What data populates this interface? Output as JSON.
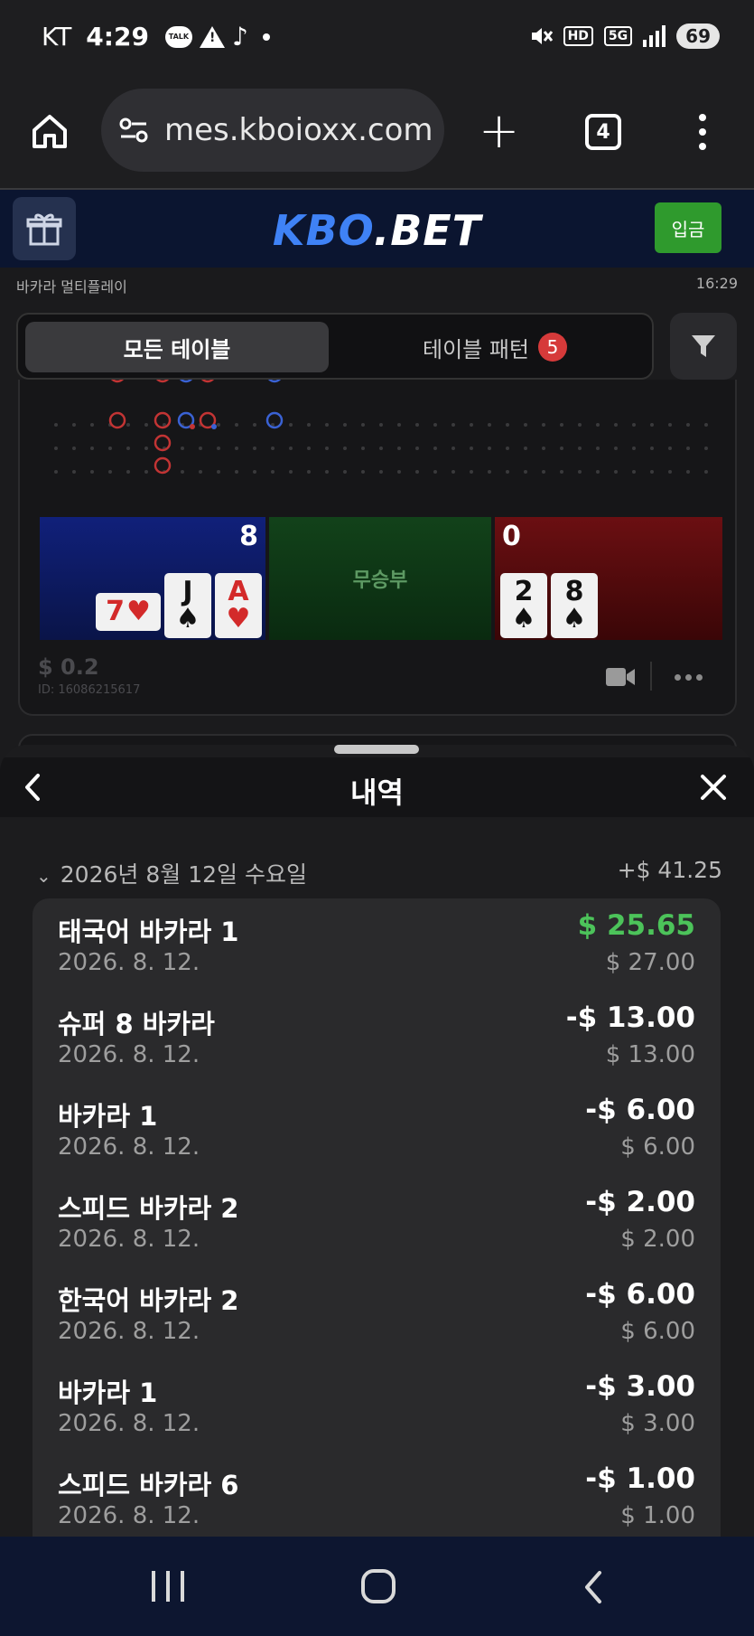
{
  "status_bar": {
    "carrier": "KT",
    "time": "4:29",
    "talk_icon_label": "TALK",
    "battery": "69",
    "hd_label": "HD",
    "net_label": "5G"
  },
  "browser": {
    "url": "mes.kboioxx.com",
    "tab_count": "4"
  },
  "site": {
    "logo_part1": "KBO",
    "logo_part2": ".BET",
    "deposit_label": "입금",
    "page_label": "바카라 멀티플레이",
    "clock": "16:29",
    "tabs": {
      "all_tables": "모든 테이블",
      "table_pattern": "테이블 패턴",
      "pattern_badge": "5"
    }
  },
  "game": {
    "player_score": "8",
    "banker_score": "0",
    "tie_label": "무승부",
    "player_cards": [
      {
        "rank": "7",
        "suit": "♥",
        "color": "red"
      },
      {
        "rank": "J",
        "suit": "♠",
        "color": "black"
      },
      {
        "rank": "A",
        "suit": "♥",
        "color": "red"
      }
    ],
    "banker_cards": [
      {
        "rank": "2",
        "suit": "♠",
        "color": "black"
      },
      {
        "rank": "8",
        "suit": "♠",
        "color": "black"
      }
    ],
    "bet_amount": "$ 0.2",
    "game_id": "ID: 16086215617"
  },
  "history": {
    "title": "내역",
    "date_header": "2026년 8월 12일 수요일",
    "date_total": "+$ 41.25",
    "items": [
      {
        "name": "태국어 바카라 1",
        "date": "2026. 8. 12.",
        "result": "$ 25.65",
        "stake": "$ 27.00",
        "win": true
      },
      {
        "name": "슈퍼 8 바카라",
        "date": "2026. 8. 12.",
        "result": "-$ 13.00",
        "stake": "$ 13.00",
        "win": false
      },
      {
        "name": "바카라 1",
        "date": "2026. 8. 12.",
        "result": "-$ 6.00",
        "stake": "$ 6.00",
        "win": false
      },
      {
        "name": "스피드 바카라 2",
        "date": "2026. 8. 12.",
        "result": "-$ 2.00",
        "stake": "$ 2.00",
        "win": false
      },
      {
        "name": "한국어 바카라 2",
        "date": "2026. 8. 12.",
        "result": "-$ 6.00",
        "stake": "$ 6.00",
        "win": false
      },
      {
        "name": "바카라 1",
        "date": "2026. 8. 12.",
        "result": "-$ 3.00",
        "stake": "$ 3.00",
        "win": false
      },
      {
        "name": "스피드 바카라 6",
        "date": "2026. 8. 12.",
        "result": "-$ 1.00",
        "stake": "$ 1.00",
        "win": false
      }
    ]
  },
  "colors": {
    "win": "#4cc35a",
    "player": "#10207a",
    "banker": "#6b0f12",
    "tie": "#12421a",
    "accent": "#3f82f6"
  }
}
